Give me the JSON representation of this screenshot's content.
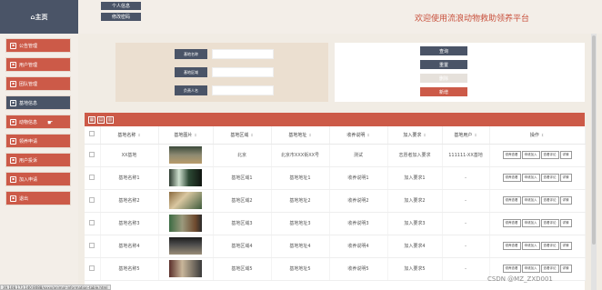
{
  "sidebar": {
    "brand": "⌂主页",
    "items": [
      {
        "label": "公告管理",
        "icon": "bulletin-icon",
        "active": false
      },
      {
        "label": "用户管理",
        "icon": "user-icon",
        "active": false
      },
      {
        "label": "团队管理",
        "icon": "team-icon",
        "active": false
      },
      {
        "label": "基地信息",
        "icon": "base-icon",
        "active": true
      },
      {
        "label": "动物信息",
        "icon": "animal-icon",
        "active": false
      },
      {
        "label": "领养申请",
        "icon": "adoption-icon",
        "active": false
      },
      {
        "label": "用户投诉",
        "icon": "complaint-icon",
        "active": false
      },
      {
        "label": "加入申请",
        "icon": "join-icon",
        "active": false
      },
      {
        "label": "退出",
        "icon": "logout-icon",
        "active": false
      }
    ]
  },
  "topbar": {
    "personal_info": "个人信息",
    "change_password": "修改密码",
    "title": "欢迎使用流浪动物救助领养平台"
  },
  "search": {
    "name_label": "基地名称",
    "area_label": "基地区域",
    "leader_label": "负责人名"
  },
  "actions": {
    "query": "查询",
    "reset": "重置",
    "delete": "删除",
    "add": "新增"
  },
  "table": {
    "headers": [
      "基地名称",
      "基地图片",
      "基地区域",
      "基地地址",
      "收养说明",
      "加入要求",
      "基地用户",
      "操作"
    ],
    "ops": [
      "领养查看",
      "申请加入",
      "查看评论",
      "详情"
    ],
    "rows": [
      {
        "name": "XX基地",
        "area": "北京",
        "address": "北京市XXX街XX号",
        "note": "测试",
        "req": "志愿者加入要求",
        "user": "111111-XX基地"
      },
      {
        "name": "基地名称1",
        "area": "基地区域1",
        "address": "基地地址1",
        "note": "收养说明1",
        "req": "加入要求1",
        "user": "-"
      },
      {
        "name": "基地名称2",
        "area": "基地区域2",
        "address": "基地地址2",
        "note": "收养说明2",
        "req": "加入要求2",
        "user": "-"
      },
      {
        "name": "基地名称3",
        "area": "基地区域3",
        "address": "基地地址3",
        "note": "收养说明3",
        "req": "加入要求3",
        "user": "-"
      },
      {
        "name": "基地名称4",
        "area": "基地区域4",
        "address": "基地地址4",
        "note": "收养说明4",
        "req": "加入要求4",
        "user": "-"
      },
      {
        "name": "基地名称5",
        "area": "基地区域5",
        "address": "基地地址5",
        "note": "收养说明5",
        "req": "加入要求5",
        "user": "-"
      }
    ]
  },
  "status_url": "39.108.173.140:8088/xxxx/animal-information-table.html",
  "watermark": "CSDN @MZ_ZXD001",
  "colors": {
    "primary": "#cc5a48",
    "dark": "#4a5467",
    "accent_text": "#c8503c",
    "bg": "#f1ece4"
  }
}
